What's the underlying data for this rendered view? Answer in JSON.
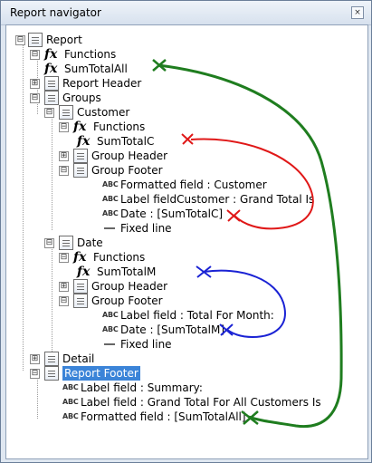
{
  "window": {
    "title": "Report navigator",
    "close": "×"
  },
  "tree": {
    "report": "Report",
    "functions_root": "Functions",
    "sum_total_all": "SumTotalAll",
    "report_header": "Report Header",
    "groups": "Groups",
    "customer": "Customer",
    "customer_functions": "Functions",
    "sum_total_c": "SumTotalC",
    "customer_group_header": "Group Header",
    "customer_group_footer": "Group Footer",
    "formatted_customer": "Formatted field : Customer",
    "label_customer": "Label fieldCustomer : Grand Total Is",
    "date_sum_c": "Date : [SumTotalC]",
    "fixed_line_1": "Fixed line",
    "date_group": "Date",
    "date_functions": "Functions",
    "sum_total_m": "SumTotalM",
    "date_group_header": "Group Header",
    "date_group_footer": "Group Footer",
    "label_total_month": "Label field : Total For Month:",
    "date_sum_m": "Date : [SumTotalM]",
    "fixed_line_2": "Fixed line",
    "detail": "Detail",
    "report_footer": "Report Footer",
    "label_summary": "Label field : Summary:",
    "label_grand_total": "Label field : Grand Total For All Customers Is",
    "formatted_sum_all": "Formatted field : [SumTotalAll]"
  },
  "annotation_colors": {
    "green": "#1f7d1f",
    "red": "#e01818",
    "blue": "#1a22d4"
  },
  "icons": {
    "expand": "⊟",
    "collapse": "⊞",
    "function": "fx",
    "text": "ABC"
  }
}
